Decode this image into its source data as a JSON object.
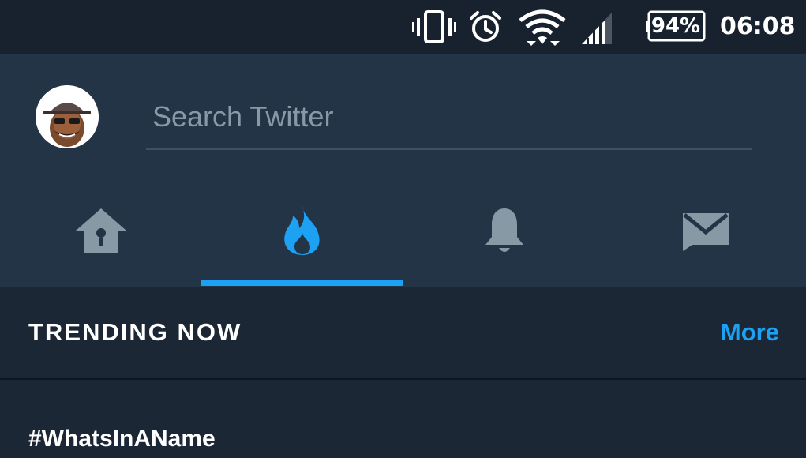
{
  "status_bar": {
    "battery_percent": "94%",
    "time": "06:08",
    "icons": [
      "vibrate-icon",
      "alarm-icon",
      "wifi-icon",
      "cell-signal-icon",
      "battery-icon"
    ]
  },
  "header": {
    "avatar_name": "profile-avatar",
    "search": {
      "placeholder": "Search Twitter",
      "value": ""
    },
    "tabs": [
      {
        "name": "home",
        "icon": "birdhouse-icon",
        "active": false
      },
      {
        "name": "explore",
        "icon": "flame-icon",
        "active": true
      },
      {
        "name": "notifications",
        "icon": "bell-icon",
        "active": false
      },
      {
        "name": "messages",
        "icon": "envelope-icon",
        "active": false
      }
    ]
  },
  "trending": {
    "title": "TRENDING NOW",
    "more_label": "More",
    "items": [
      {
        "name": "#WhatsInAName"
      }
    ]
  },
  "colors": {
    "status_bar_bg": "#17222e",
    "header_bg": "#243447",
    "body_bg": "#1b2735",
    "accent": "#1da1f2",
    "inactive_icon": "#8899a6"
  }
}
